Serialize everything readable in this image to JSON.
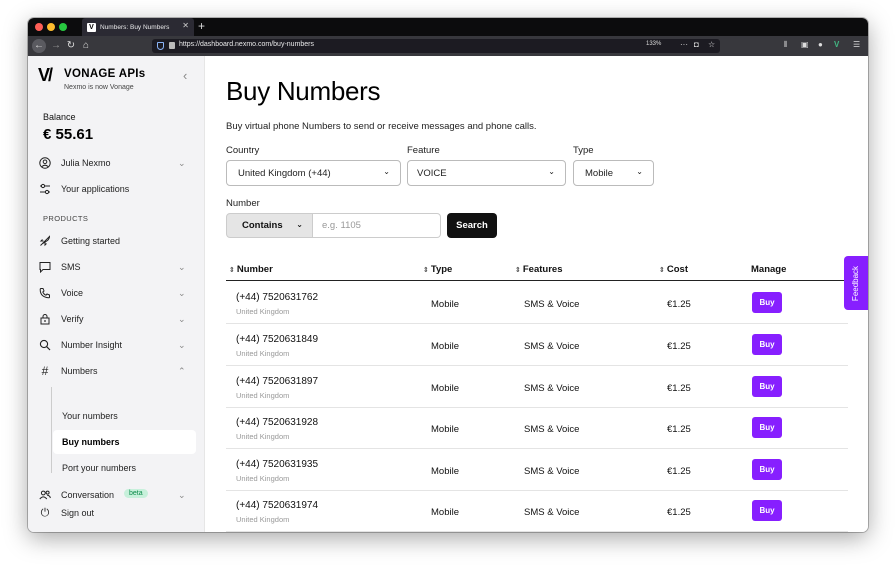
{
  "browser": {
    "tab_title": "Numbers: Buy Numbers",
    "tab_favicon": "V",
    "url": "https://dashboard.nexmo.com/buy-numbers",
    "zoom": "133%",
    "traffic_colors": [
      "#ff5f57",
      "#febc2e",
      "#28c840"
    ]
  },
  "sidebar": {
    "brand_mark": "V/",
    "brand_name": "VONAGE APIs",
    "brand_sub": "Nexmo is now Vonage",
    "collapse_icon": "chevron-left-icon",
    "balance_label": "Balance",
    "balance_value": "€ 55.61",
    "user": {
      "label": "Julia Nexmo",
      "icon": "user-circle-icon"
    },
    "applications": {
      "label": "Your applications",
      "icon": "sliders-icon"
    },
    "products_label": "PRODUCTS",
    "items": [
      {
        "label": "Getting started",
        "icon": "rocket-icon",
        "chevron": false
      },
      {
        "label": "SMS",
        "icon": "chat-bubble-icon",
        "chevron": true
      },
      {
        "label": "Voice",
        "icon": "phone-icon",
        "chevron": true
      },
      {
        "label": "Verify",
        "icon": "lock-icon",
        "chevron": true
      },
      {
        "label": "Number Insight",
        "icon": "search-icon",
        "chevron": true
      },
      {
        "label": "Numbers",
        "icon": "hash-icon",
        "chevron": true,
        "expanded": true
      }
    ],
    "numbers_sub": [
      {
        "label": "Your numbers",
        "active": false
      },
      {
        "label": "Buy numbers",
        "active": true
      },
      {
        "label": "Port your numbers",
        "active": false
      }
    ],
    "conversation": {
      "label": "Conversation",
      "badge": "beta",
      "icon": "people-icon"
    },
    "sign_out": {
      "label": "Sign out",
      "icon": "power-icon"
    }
  },
  "main": {
    "title": "Buy Numbers",
    "description": "Buy virtual phone Numbers to send or receive messages and phone calls.",
    "filters": {
      "country_label": "Country",
      "country_value": "United Kingdom (+44)",
      "feature_label": "Feature",
      "feature_value": "VOICE",
      "type_label": "Type",
      "type_value": "Mobile",
      "number_label": "Number",
      "match_value": "Contains",
      "number_placeholder": "e.g. 1105",
      "search_label": "Search"
    },
    "columns": {
      "number": "Number",
      "type": "Type",
      "features": "Features",
      "cost": "Cost",
      "manage": "Manage"
    },
    "rows": [
      {
        "number": "(+44) 7520631762",
        "country": "United Kingdom",
        "type": "Mobile",
        "features": "SMS & Voice",
        "cost": "€1.25",
        "action": "Buy"
      },
      {
        "number": "(+44) 7520631849",
        "country": "United Kingdom",
        "type": "Mobile",
        "features": "SMS & Voice",
        "cost": "€1.25",
        "action": "Buy"
      },
      {
        "number": "(+44) 7520631897",
        "country": "United Kingdom",
        "type": "Mobile",
        "features": "SMS & Voice",
        "cost": "€1.25",
        "action": "Buy"
      },
      {
        "number": "(+44) 7520631928",
        "country": "United Kingdom",
        "type": "Mobile",
        "features": "SMS & Voice",
        "cost": "€1.25",
        "action": "Buy"
      },
      {
        "number": "(+44) 7520631935",
        "country": "United Kingdom",
        "type": "Mobile",
        "features": "SMS & Voice",
        "cost": "€1.25",
        "action": "Buy"
      },
      {
        "number": "(+44) 7520631974",
        "country": "United Kingdom",
        "type": "Mobile",
        "features": "SMS & Voice",
        "cost": "€1.25",
        "action": "Buy"
      }
    ],
    "feedback_label": "Feedback",
    "accent_color": "#871fff"
  }
}
